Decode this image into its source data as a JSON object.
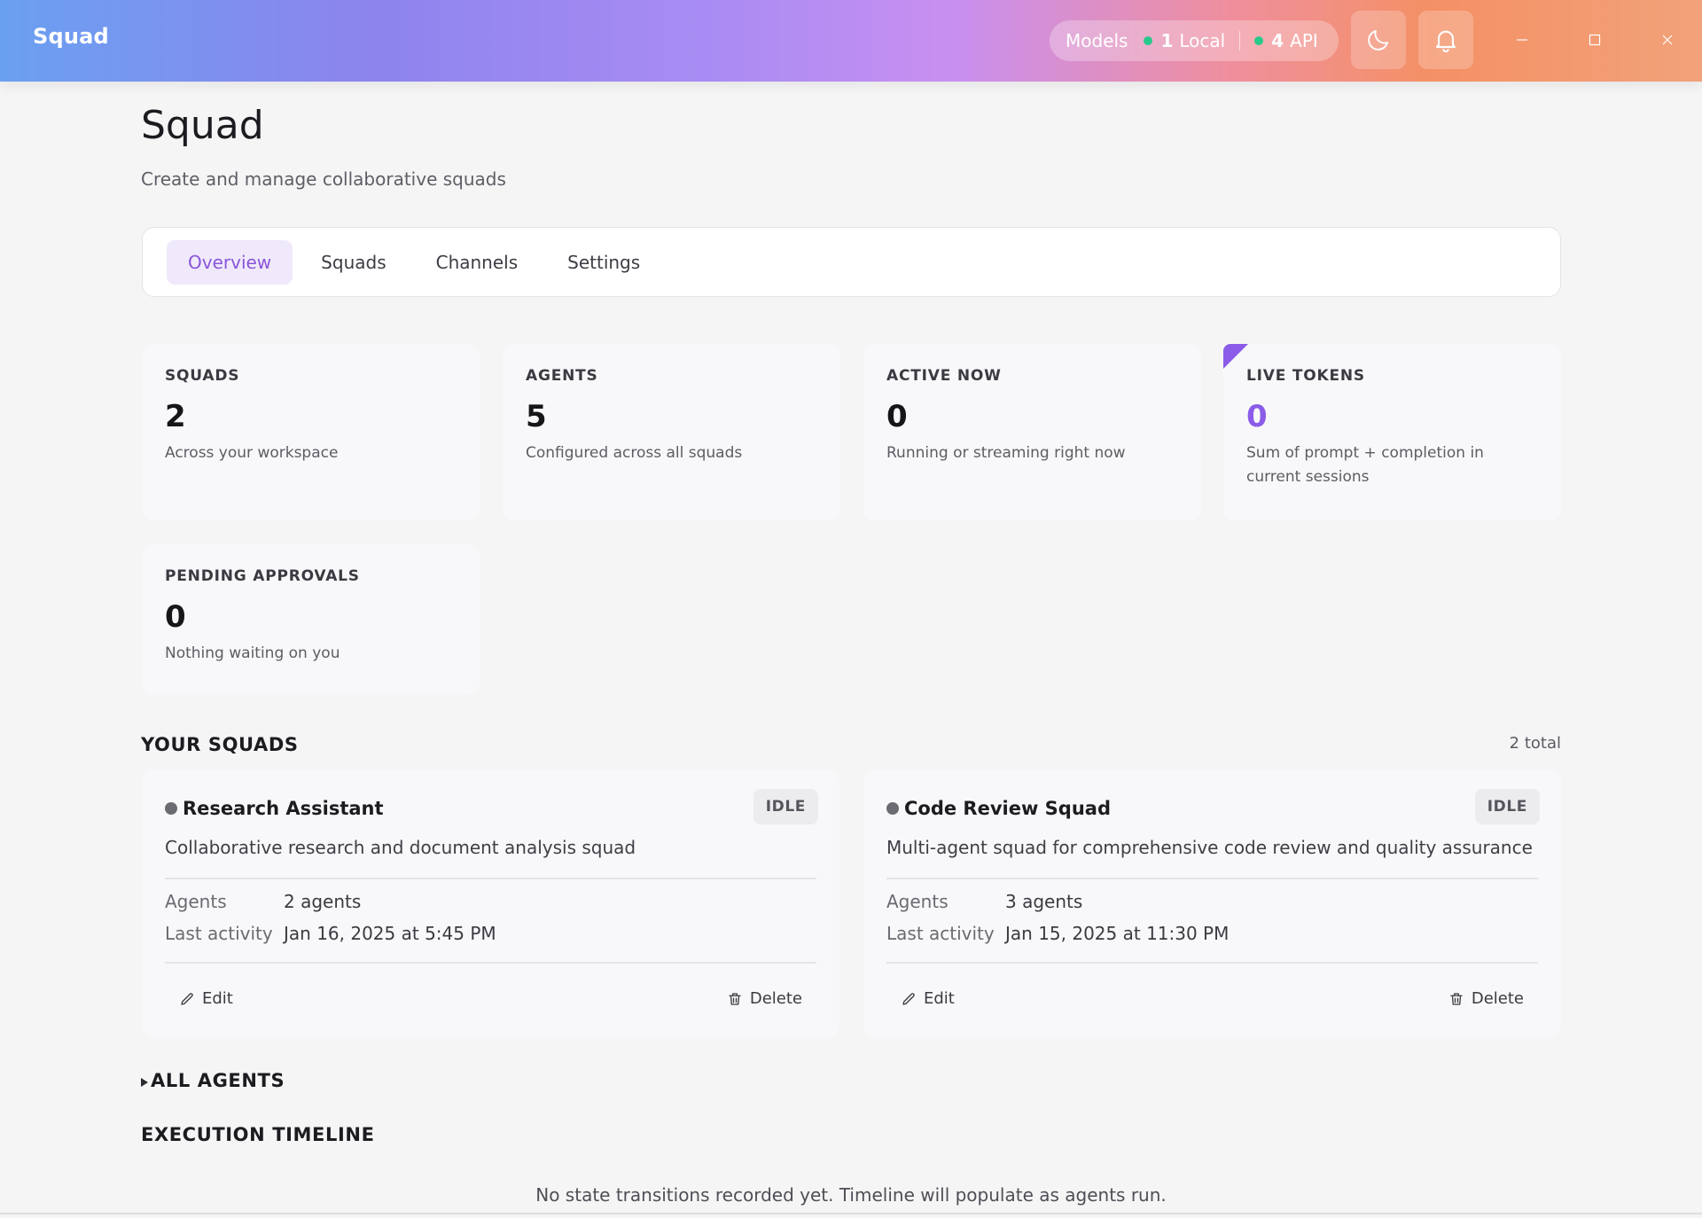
{
  "app": {
    "title": "Squad"
  },
  "header": {
    "models_label": "Models",
    "local_count": "1",
    "local_label": "Local",
    "api_count": "4",
    "api_label": "API",
    "status_color": "#29c98b"
  },
  "page": {
    "title": "Squad",
    "subtitle": "Create and manage collaborative squads"
  },
  "tabs": [
    {
      "label": "Overview",
      "active": true
    },
    {
      "label": "Squads",
      "active": false
    },
    {
      "label": "Channels",
      "active": false
    },
    {
      "label": "Settings",
      "active": false
    }
  ],
  "stats": [
    {
      "label": "SQUADS",
      "value": "2",
      "desc": "Across your workspace"
    },
    {
      "label": "AGENTS",
      "value": "5",
      "desc": "Configured across all squads"
    },
    {
      "label": "ACTIVE NOW",
      "value": "0",
      "desc": "Running or streaming right now"
    },
    {
      "label": "LIVE TOKENS",
      "value": "0",
      "desc": "Sum of prompt + completion in current sessions"
    },
    {
      "label": "PENDING APPROVALS",
      "value": "0",
      "desc": "Nothing waiting on you"
    }
  ],
  "your_squads": {
    "heading": "YOUR SQUADS",
    "total": "2 total",
    "items": [
      {
        "name": "Research Assistant",
        "status": "IDLE",
        "description": "Collaborative research and document analysis squad",
        "agents_label": "Agents",
        "agents_value": "2 agents",
        "last_activity_label": "Last activity",
        "last_activity_value": "Jan 16, 2025 at 5:45 PM",
        "edit_label": "Edit",
        "delete_label": "Delete"
      },
      {
        "name": "Code Review Squad",
        "status": "IDLE",
        "description": "Multi-agent squad for comprehensive code review and quality assurance",
        "agents_label": "Agents",
        "agents_value": "3 agents",
        "last_activity_label": "Last activity",
        "last_activity_value": "Jan 15, 2025 at 11:30 PM",
        "edit_label": "Edit",
        "delete_label": "Delete"
      }
    ]
  },
  "all_agents": {
    "heading": "ALL AGENTS"
  },
  "timeline": {
    "heading": "EXECUTION TIMELINE",
    "empty": "No state transitions recorded yet. Timeline will populate as agents run."
  },
  "colors": {
    "accent": "#8a5ce8",
    "tab_active_bg": "#efe9fb"
  }
}
